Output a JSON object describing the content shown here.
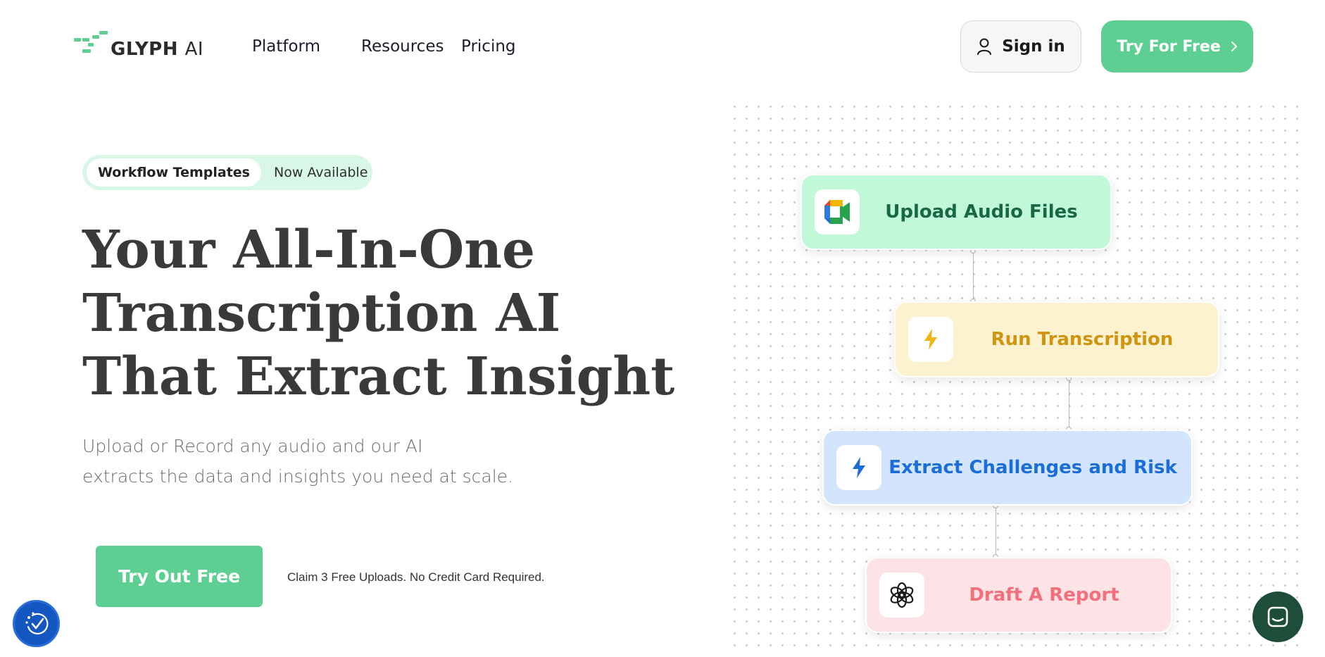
{
  "header": {
    "logo": {
      "brand": "GLYPH",
      "suffix": "AI"
    },
    "nav": [
      {
        "label": "Platform"
      },
      {
        "label": "Resources"
      },
      {
        "label": "Pricing"
      }
    ],
    "sign_in_label": "Sign in",
    "try_free_label": "Try For Free"
  },
  "hero": {
    "badge": {
      "pill": "Workflow Templates",
      "text": "Now Available"
    },
    "headline": [
      "Your All-In-One",
      "Transcription AI",
      "That Extract Insight"
    ],
    "subtext": [
      "Upload or Record any audio and our AI",
      "extracts the data and insights you need at scale."
    ],
    "cta_label": "Try Out Free",
    "cta_note": "Claim 3 Free Uploads. No Credit Card Required."
  },
  "workflow": [
    {
      "label": "Upload Audio Files",
      "icon": "google-meet-icon",
      "color": "#186846",
      "bg": "#c1f9d8"
    },
    {
      "label": "Run Transcription",
      "icon": "lightning-icon",
      "color": "#cf9511",
      "bg": "#fdf2cf"
    },
    {
      "label": "Extract Challenges and Risk",
      "icon": "lightning-icon",
      "color": "#1a6ed6",
      "bg": "#d2e5fd"
    },
    {
      "label": "Draft A Report",
      "icon": "openai-icon",
      "color": "#f1707b",
      "bg": "#fde3e5"
    }
  ],
  "colors": {
    "accent": "#5ecf93",
    "accessibility": "#1557c0",
    "chat": "#1e4d3a"
  },
  "widgets": {
    "accessibility_icon": "accessibility-icon",
    "chat_icon": "chat-icon"
  }
}
